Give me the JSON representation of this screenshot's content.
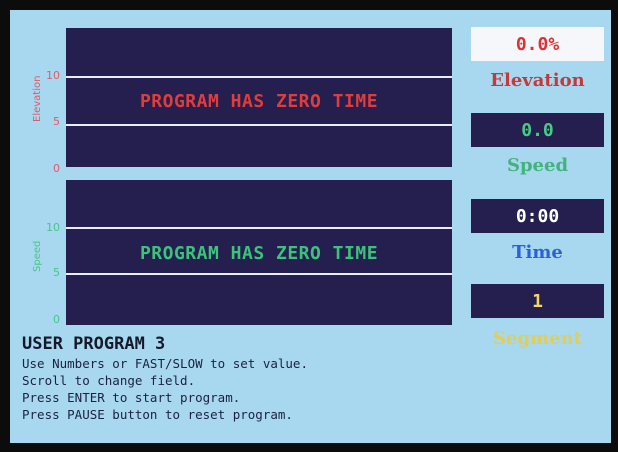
{
  "elevation_chart": {
    "axis_title": "Elevation",
    "ticks": [
      "10",
      "5",
      "0"
    ],
    "message": "PROGRAM HAS ZERO TIME",
    "color": "#e03c3c"
  },
  "speed_chart": {
    "axis_title": "Speed",
    "ticks": [
      "10",
      "5",
      "0"
    ],
    "message": "PROGRAM HAS ZERO TIME",
    "color": "#3cc27a"
  },
  "fields": {
    "elevation": {
      "value": "0.0%",
      "label": "Elevation",
      "label_color": "#c43a3a"
    },
    "speed": {
      "value": "0.0",
      "label": "Speed",
      "label_color": "#43b27d"
    },
    "time": {
      "value": "0:00",
      "label": "Time",
      "label_color": "#2f5fd6"
    },
    "segment": {
      "value": "1",
      "label": "Segment",
      "label_color": "#e2cd55"
    }
  },
  "program": {
    "title": "USER PROGRAM 3",
    "instructions": [
      "Use Numbers or FAST/SLOW to set value.",
      "Scroll to change field.",
      "Press ENTER to start program.",
      "Press PAUSE button to reset program."
    ]
  }
}
